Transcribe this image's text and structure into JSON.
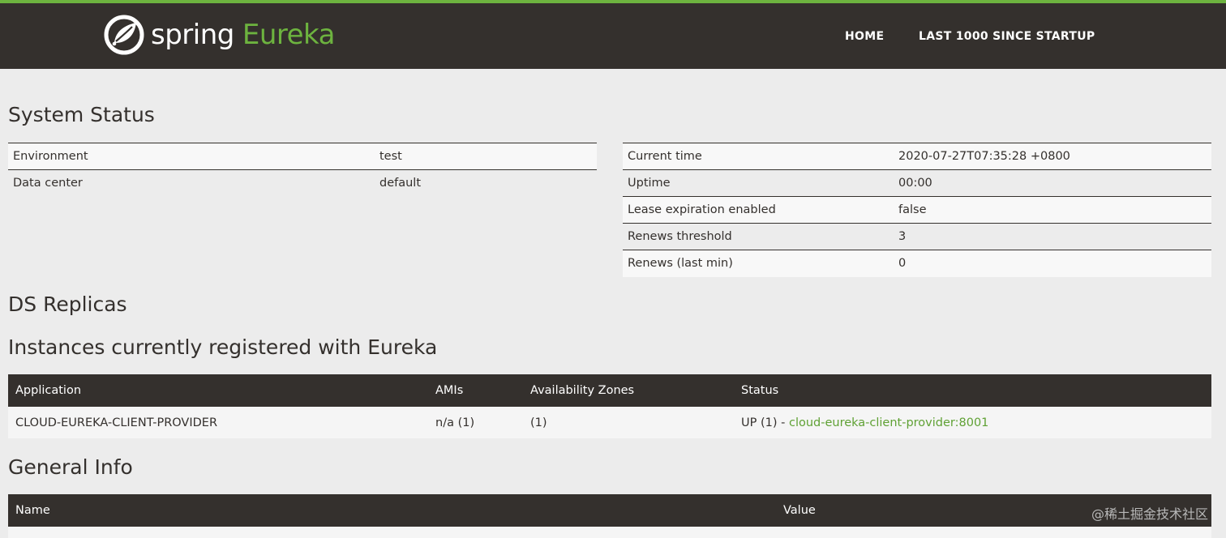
{
  "header": {
    "logo_word_1": "spring",
    "logo_word_2": "Eureka",
    "nav": [
      "HOME",
      "LAST 1000 SINCE STARTUP"
    ]
  },
  "system_status": {
    "title": "System Status",
    "left": [
      {
        "key": "Environment",
        "value": "test"
      },
      {
        "key": "Data center",
        "value": "default"
      }
    ],
    "right": [
      {
        "key": "Current time",
        "value": "2020-07-27T07:35:28 +0800"
      },
      {
        "key": "Uptime",
        "value": "00:00"
      },
      {
        "key": "Lease expiration enabled",
        "value": "false"
      },
      {
        "key": "Renews threshold",
        "value": "3"
      },
      {
        "key": "Renews (last min)",
        "value": "0"
      }
    ]
  },
  "ds_replicas": {
    "title": "DS Replicas"
  },
  "instances": {
    "title": "Instances currently registered with Eureka",
    "columns": [
      "Application",
      "AMIs",
      "Availability Zones",
      "Status"
    ],
    "rows": [
      {
        "application": "CLOUD-EUREKA-CLIENT-PROVIDER",
        "amis": "n/a (1)",
        "zones": "(1)",
        "status_prefix": "UP (1) - ",
        "status_link": "cloud-eureka-client-provider:8001"
      }
    ]
  },
  "general_info": {
    "title": "General Info",
    "columns": [
      "Name",
      "Value"
    ]
  },
  "watermark": "@稀土掘金技术社区",
  "colors": {
    "navbar_bg": "#34302d",
    "accent_green": "#6db33f",
    "page_bg": "#ececec"
  },
  "icons": {
    "logo": "spring-leaf-icon"
  }
}
